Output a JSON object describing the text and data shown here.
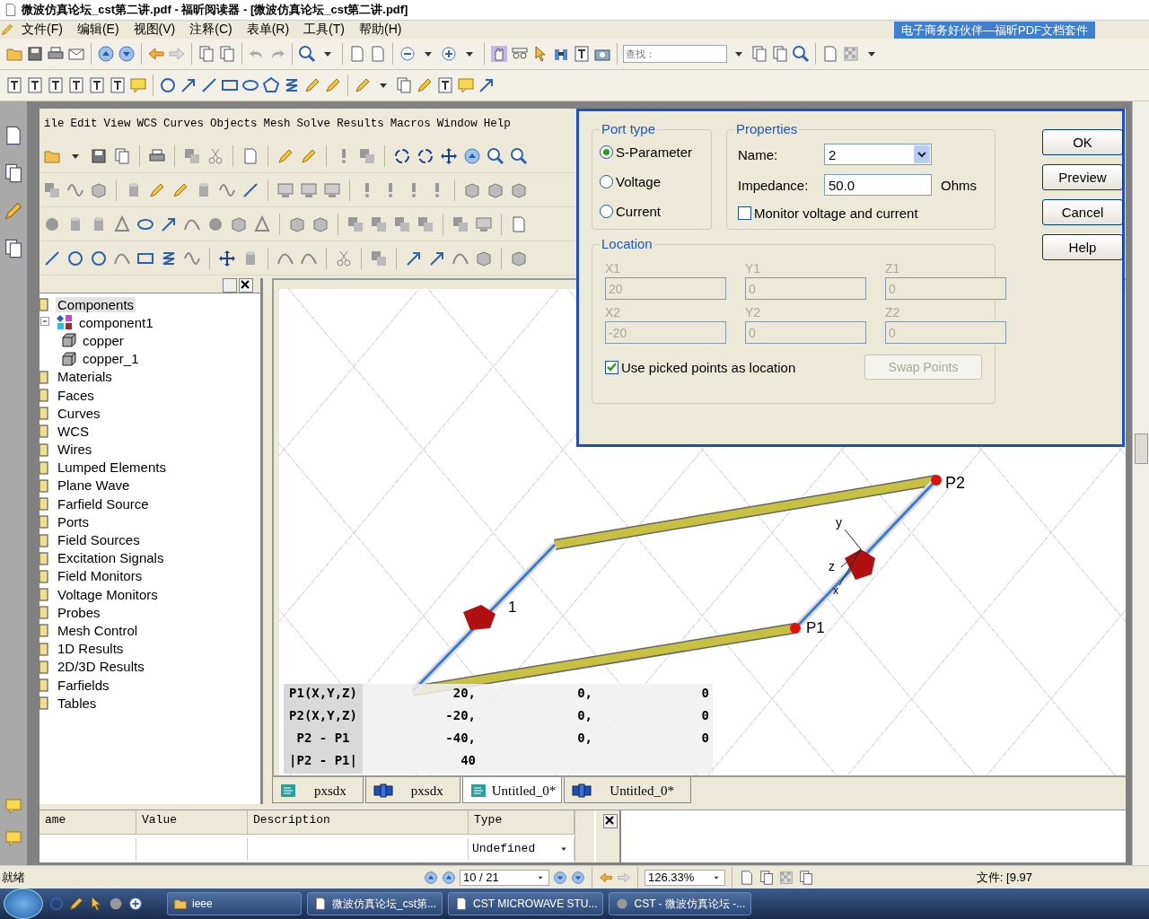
{
  "window": {
    "title": "微波仿真论坛_cst第二讲.pdf - 福昕阅读器 - [微波仿真论坛_cst第二讲.pdf]"
  },
  "menu": [
    "文件(F)",
    "编辑(E)",
    "视图(V)",
    "注释(C)",
    "表单(R)",
    "工具(T)",
    "帮助(H)"
  ],
  "banner": "电子商务好伙伴—福昕PDF文档套件",
  "search": {
    "placeholder": "查找："
  },
  "cst": {
    "menu": [
      "ile",
      "Edit",
      "View",
      "WCS",
      "Curves",
      "Objects",
      "Mesh",
      "Solve",
      "Results",
      "Macros",
      "Window",
      "Help"
    ],
    "tree": [
      {
        "label": "Components",
        "selected": true,
        "children": [
          {
            "label": "component1",
            "selected": false,
            "children": [
              {
                "label": "copper",
                "selected": false
              },
              {
                "label": "copper_1",
                "selected": false
              }
            ]
          }
        ]
      },
      {
        "label": "Materials",
        "selected": false
      },
      {
        "label": "Faces",
        "selected": false
      },
      {
        "label": "Curves",
        "selected": false
      },
      {
        "label": "WCS",
        "selected": false
      },
      {
        "label": "Wires",
        "selected": false
      },
      {
        "label": "Lumped Elements",
        "selected": false
      },
      {
        "label": "Plane Wave",
        "selected": false
      },
      {
        "label": "Farfield Source",
        "selected": false
      },
      {
        "label": "Ports",
        "selected": false
      },
      {
        "label": "Field Sources",
        "selected": false
      },
      {
        "label": "Excitation Signals",
        "selected": false
      },
      {
        "label": "Field Monitors",
        "selected": false
      },
      {
        "label": "Voltage Monitors",
        "selected": false
      },
      {
        "label": "Probes",
        "selected": false
      },
      {
        "label": "Mesh Control",
        "selected": false
      },
      {
        "label": "1D Results",
        "selected": false
      },
      {
        "label": "2D/3D Results",
        "selected": false
      },
      {
        "label": "Farfields",
        "selected": false
      },
      {
        "label": "Tables",
        "selected": false
      }
    ],
    "scene_labels": {
      "port1": "1",
      "p1": "P1",
      "p2": "P2",
      "axis_y": "y",
      "axis_z": "z",
      "axis_x": "x"
    },
    "coords": [
      {
        "label": "P1(X,Y,Z)",
        "values": [
          "20,",
          "0,",
          "0"
        ]
      },
      {
        "label": "P2(X,Y,Z)",
        "values": [
          "-20,",
          "0,",
          "0"
        ]
      },
      {
        "label": "P2 - P1",
        "values": [
          "-40,",
          "0,",
          "0"
        ]
      },
      {
        "label": "|P2 - P1|",
        "values": [
          "40"
        ]
      }
    ],
    "tabs": [
      {
        "label": "pxsdx",
        "kind": "schematic",
        "selected": false
      },
      {
        "label": "pxsdx",
        "kind": "model",
        "selected": false
      },
      {
        "label": "Untitled_0*",
        "kind": "schematic",
        "selected": true
      },
      {
        "label": "Untitled_0*",
        "kind": "model",
        "selected": false
      }
    ],
    "params": {
      "columns": [
        "ame",
        "Value",
        "Description",
        "Type"
      ],
      "rows": [
        {
          "type": "Undefined"
        }
      ]
    }
  },
  "dialog": {
    "port_type": {
      "title": "Port type",
      "options": [
        {
          "label": "S-Parameter",
          "selected": true
        },
        {
          "label": "Voltage",
          "selected": false
        },
        {
          "label": "Current",
          "selected": false
        }
      ]
    },
    "properties": {
      "title": "Properties",
      "name_label": "Name:",
      "name_value": "2",
      "impedance_label": "Impedance:",
      "impedance_value": "50.0",
      "unit": "Ohms",
      "monitor": {
        "label": "Monitor voltage and current",
        "checked": false
      }
    },
    "location": {
      "title": "Location",
      "fields": [
        {
          "label": "X1",
          "value": "20",
          "disabled": true
        },
        {
          "label": "Y1",
          "value": "0",
          "disabled": true
        },
        {
          "label": "Z1",
          "value": "0",
          "disabled": true
        },
        {
          "label": "X2",
          "value": "-20",
          "disabled": true
        },
        {
          "label": "Y2",
          "value": "0",
          "disabled": true
        },
        {
          "label": "Z2",
          "value": "0",
          "disabled": true
        }
      ],
      "use_picked": {
        "label": "Use picked points as location",
        "checked": true
      },
      "swap_button": {
        "label": "Swap Points",
        "disabled": true
      }
    },
    "buttons": [
      "OK",
      "Preview",
      "Cancel",
      "Help"
    ]
  },
  "status_bar": {
    "text": "就绪",
    "page": "10 / 21",
    "zoom": "126.33%",
    "file_info": "文件: [9.97"
  },
  "taskbar": {
    "tasks": [
      "ieee",
      "微波仿真论坛_cst第...",
      "CST MICROWAVE STU...",
      "CST - 微波仿真论坛 -..."
    ]
  }
}
